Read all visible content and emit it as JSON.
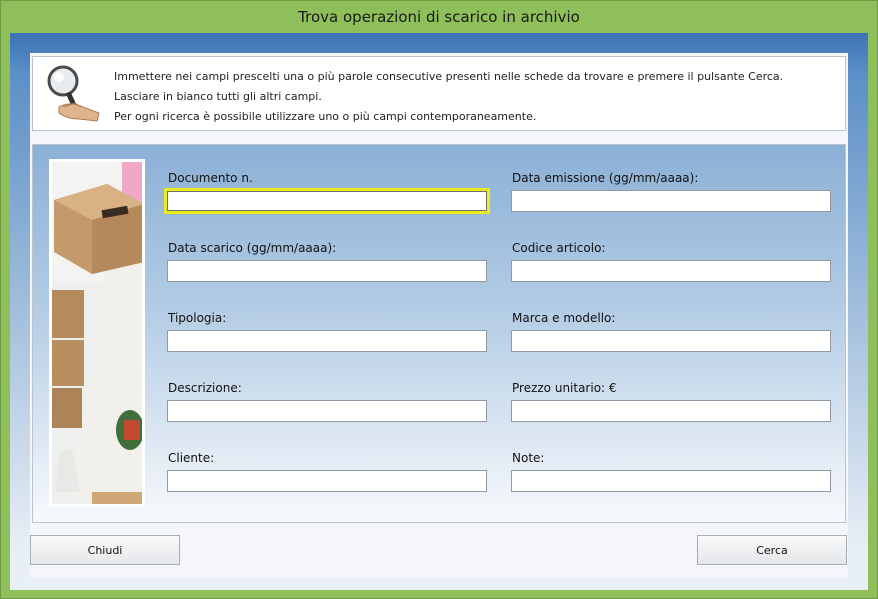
{
  "window": {
    "title": "Trova operazioni di scarico in archivio"
  },
  "info": {
    "lines": [
      "Immettere nei campi prescelti una o più parole consecutive presenti nelle schede da trovare e premere il pulsante Cerca.",
      "Lasciare in bianco tutti gli altri campi.",
      "Per ogni ricerca è possibile utilizzare uno o più campi contemporaneamente."
    ]
  },
  "fields": {
    "documento": {
      "label": "Documento n.",
      "value": ""
    },
    "data_emissione": {
      "label": "Data emissione (gg/mm/aaaa):",
      "value": ""
    },
    "data_scarico": {
      "label": "Data scarico (gg/mm/aaaa):",
      "value": ""
    },
    "codice_articolo": {
      "label": "Codice articolo:",
      "value": ""
    },
    "tipologia": {
      "label": "Tipologia:",
      "value": ""
    },
    "marca_modello": {
      "label": "Marca e modello:",
      "value": ""
    },
    "descrizione": {
      "label": "Descrizione:",
      "value": ""
    },
    "prezzo_unitario": {
      "label": "Prezzo unitario: €",
      "value": ""
    },
    "cliente": {
      "label": "Cliente:",
      "value": ""
    },
    "note": {
      "label": "Note:",
      "value": ""
    }
  },
  "buttons": {
    "close": "Chiudi",
    "search": "Cerca"
  },
  "colors": {
    "titlebar": "#8fbf5a",
    "frame": "#3b73b5",
    "focus": "#ecec1a"
  }
}
